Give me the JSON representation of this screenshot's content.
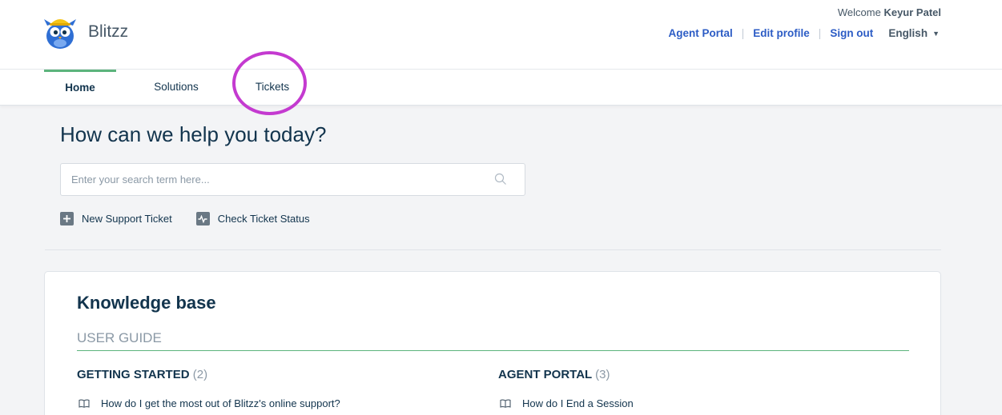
{
  "brand": {
    "name": "Blitzz"
  },
  "header": {
    "welcome_prefix": "Welcome",
    "user_name": "Keyur Patel",
    "links": {
      "agent_portal": "Agent Portal",
      "edit_profile": "Edit profile",
      "sign_out": "Sign out"
    },
    "language": "English"
  },
  "tabs": [
    {
      "label": "Home",
      "active": true
    },
    {
      "label": "Solutions",
      "active": false
    },
    {
      "label": "Tickets",
      "active": false
    }
  ],
  "hero": {
    "title": "How can we help you today?",
    "search_placeholder": "Enter your search term here..."
  },
  "actions": {
    "new_ticket": "New Support Ticket",
    "check_status": "Check Ticket Status"
  },
  "knowledge_base": {
    "title": "Knowledge base",
    "category": "USER GUIDE",
    "folders": [
      {
        "name": "GETTING STARTED",
        "count": "(2)",
        "articles": [
          "How do I get the most out of Blitzz's online support?"
        ]
      },
      {
        "name": "AGENT PORTAL",
        "count": "(3)",
        "articles": [
          "How do I End a Session"
        ]
      }
    ]
  },
  "colors": {
    "accent_green": "#5cb47c",
    "link_blue": "#2c5cc5",
    "annotation_magenta": "#c43ad0",
    "text_dark": "#12344d"
  }
}
